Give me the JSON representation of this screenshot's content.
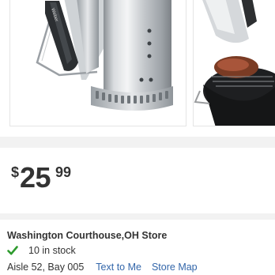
{
  "product": {
    "images": [
      {
        "name": "chimney-starter-product-photo"
      },
      {
        "name": "chimney-starter-in-use-photo"
      }
    ]
  },
  "price": {
    "currency": "$",
    "dollars": "25",
    "cents": "99"
  },
  "store": {
    "name": "Washington Courthouse,OH Store",
    "stock_text": "10 in stock",
    "aisle_bay": "Aisle 52, Bay 005",
    "text_to_me_label": "Text to Me",
    "store_map_label": "Store Map"
  },
  "colors": {
    "link": "#3366aa",
    "stock_check": "#2e9b2e",
    "section_gap": "#f2f2f2"
  },
  "icons": {
    "stock": "check-icon"
  }
}
